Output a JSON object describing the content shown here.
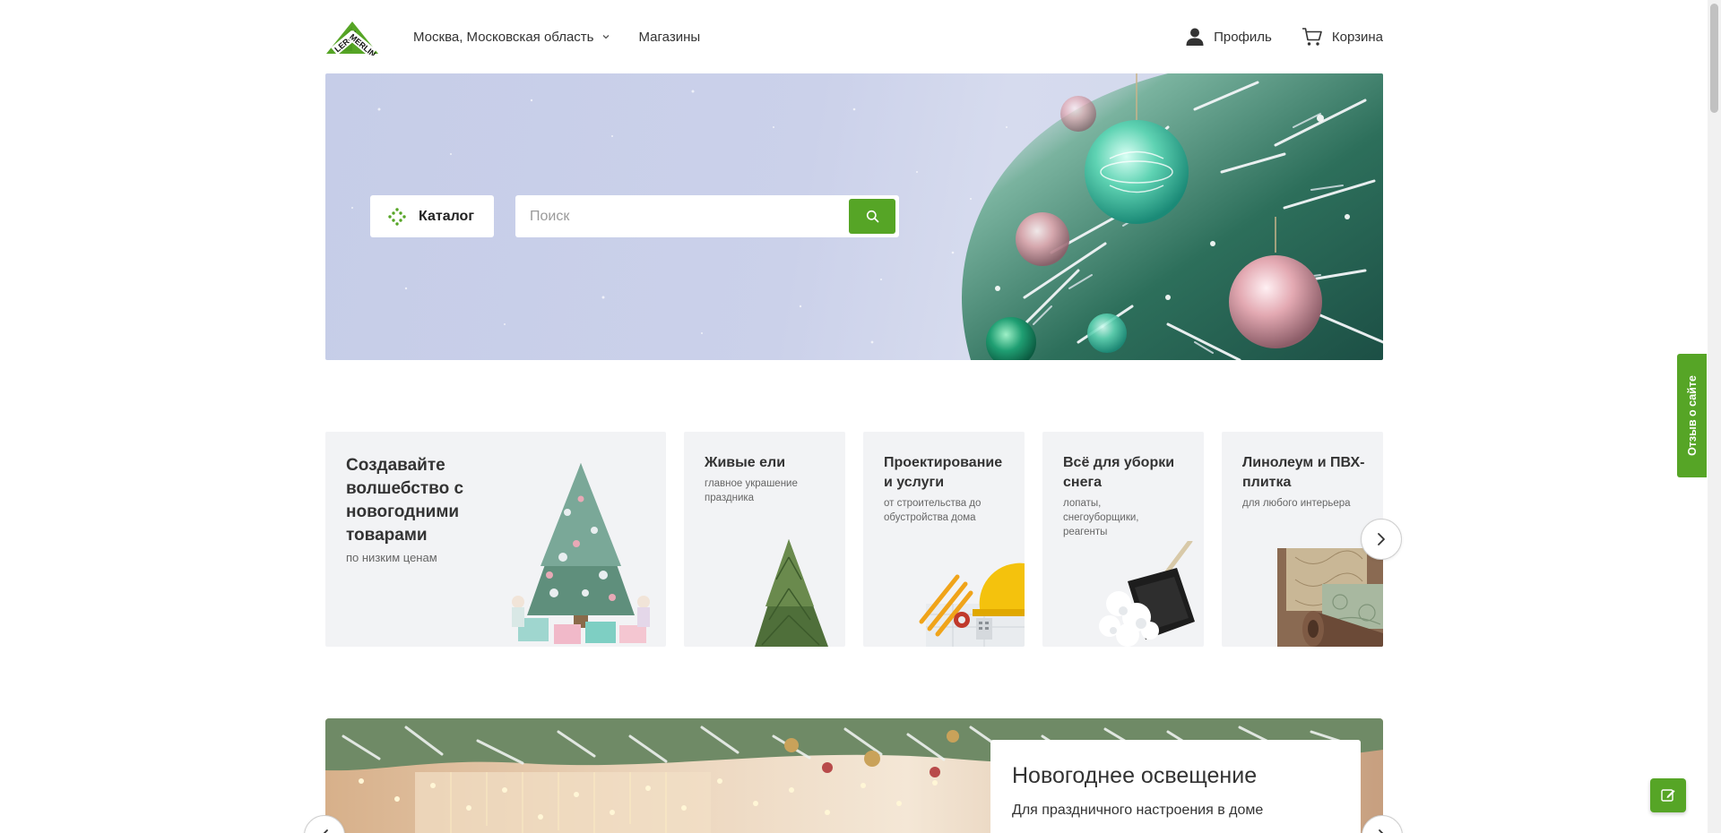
{
  "header": {
    "logo_text": "LEROY MERLIN",
    "region": "Москва, Московская область",
    "stores": "Магазины",
    "profile": "Профиль",
    "cart": "Корзина"
  },
  "hero": {
    "catalog_label": "Каталог",
    "search_placeholder": "Поиск"
  },
  "cards": [
    {
      "title": "Создавайте волшебство с новогодними товарами",
      "subtitle": "по низким ценам"
    },
    {
      "title": "Живые ели",
      "subtitle": "главное украшение праздника"
    },
    {
      "title": "Проектирование и услуги",
      "subtitle": "от строительства до обустройства дома"
    },
    {
      "title": "Всё для уборки снега",
      "subtitle": "лопаты, снегоуборщики, реагенты"
    },
    {
      "title": "Линолеум и ПВХ-плитка",
      "subtitle": "для любого интерьера"
    }
  ],
  "promo": {
    "title": "Новогоднее освещение",
    "subtitle": "Для праздничного настроения в доме"
  },
  "feedback_label": "Отзыв о сайте",
  "colors": {
    "brand_green": "#56a526",
    "card_bg": "#f2f3f5",
    "hero_bg": "#c6cde8"
  },
  "icons": {
    "profile": "user-icon",
    "cart": "cart-icon",
    "catalog": "catalog-dots-icon",
    "search": "search-icon",
    "edit": "edit-icon"
  }
}
